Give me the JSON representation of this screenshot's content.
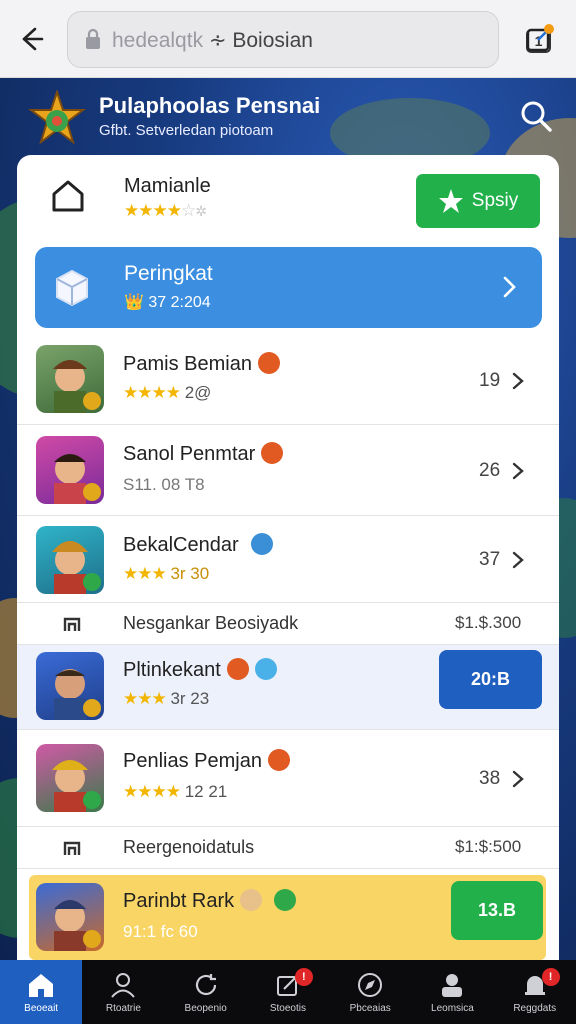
{
  "browser": {
    "url_main": "hedealqtk",
    "url_dim": "∻",
    "url_rest": "Boiosian",
    "tabs_count": "1"
  },
  "header": {
    "title": "Pulaphoolas Pensnai",
    "subtitle": "Gfbt. Setverledan piotoam"
  },
  "top_item": {
    "name": "Mamianle",
    "rating": 4,
    "button_label": "Spsiy"
  },
  "rank_banner": {
    "title": "Peringkat",
    "subtitle": "37 2:204"
  },
  "rows": [
    {
      "name": "Pamis Bemian",
      "sub": "2@",
      "rating": 4,
      "number": "19"
    },
    {
      "name": "Sanol Penmtar",
      "sub": "S11. 08 T8",
      "number": "26"
    },
    {
      "name": "BekalCendar",
      "sub": "3r 30",
      "rating": 3,
      "number": "37"
    },
    {
      "name": "Pltinkekant",
      "sub": "3r 23",
      "rating": 3,
      "button_label": "20:B"
    },
    {
      "name": "Penlias Pemjan",
      "sub": "12 21",
      "rating": 4,
      "number": "38"
    },
    {
      "name": "Parinbt Rark",
      "sub": "91:1 fc 60",
      "button_label": "13.B"
    }
  ],
  "sections": [
    {
      "label": "Nesgankar Beosiyadk",
      "price": "$1.$.300"
    },
    {
      "label": "Reergenoidatuls",
      "price": "$1:$:500"
    }
  ],
  "bottom_nav": [
    {
      "label": "Beoeait",
      "icon": "home-icon",
      "active": true
    },
    {
      "label": "Rtoatrie",
      "icon": "person-icon"
    },
    {
      "label": "Beopenio",
      "icon": "refresh-icon"
    },
    {
      "label": "Stoeotis",
      "icon": "edit-icon",
      "badge": "!"
    },
    {
      "label": "Pbceaias",
      "icon": "compass-icon"
    },
    {
      "label": "Leomsica",
      "icon": "profile-icon"
    },
    {
      "label": "Reggdats",
      "icon": "bell-icon",
      "badge": "!"
    }
  ],
  "colors": {
    "green": "#21b04a",
    "blue": "#3c8fe0",
    "dark_blue_button": "#1f5fbf",
    "yellow_row": "#f8d565",
    "star": "#f2b600"
  }
}
